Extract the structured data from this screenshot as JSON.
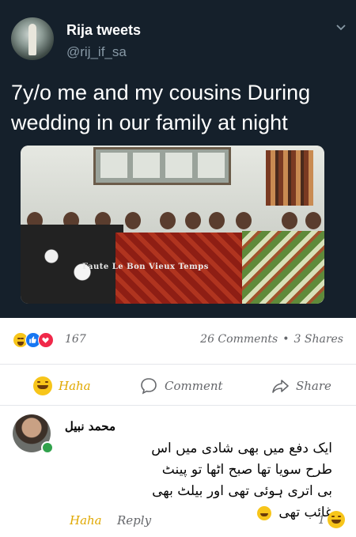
{
  "tweet": {
    "author_name": "Rija tweets",
    "handle": "@rij_if_sa",
    "text": "7y/o me and my cousins During wedding in our family at night",
    "photo_watermark": "Faute Le Bon Vieux Temps",
    "colors": {
      "background": "#15202b",
      "handle": "#8899a6"
    }
  },
  "post": {
    "reaction_count": "167",
    "comments_label": "26 Comments",
    "shares_label": "3 Shares",
    "separator": "•",
    "actions": {
      "haha_label": "Haha",
      "comment_label": "Comment",
      "share_label": "Share"
    }
  },
  "comment": {
    "author": "محمد نبیل",
    "text": "ایک دفع میں بھی شادی میں اس طرح سویا تھا صبح اٹھا تو پینٹ بی اتری ہوئی تھی اور بیلٹ بھی غائب تھی",
    "haha_label": "Haha",
    "reply_label": "Reply",
    "reaction_count": "1"
  },
  "colors": {
    "haha": "#e0a800",
    "muted": "#65676b",
    "like": "#1877f2",
    "love": "#f02849"
  }
}
